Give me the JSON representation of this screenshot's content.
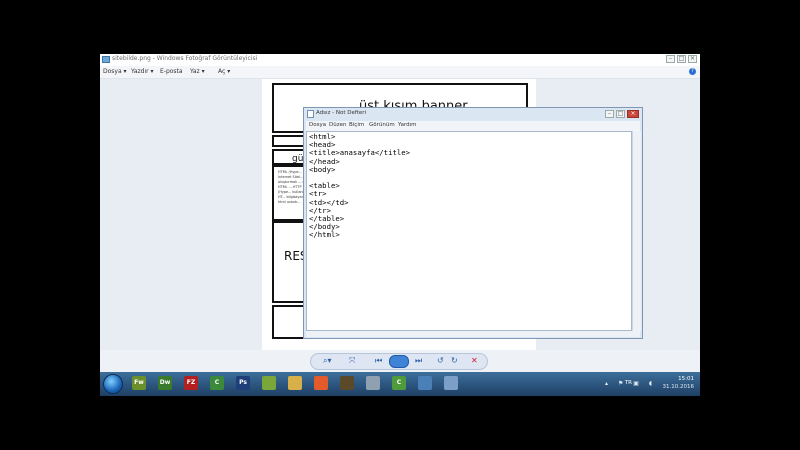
{
  "photo_viewer": {
    "title": "sitebilde.png - Windows Fotoğraf Görüntüleyicisi",
    "menu": [
      "Dosya ▾",
      "Yazdır ▾",
      "E-posta",
      "Yaz ▾",
      "Aç ▾"
    ],
    "image": {
      "banner": "üst kısım banner",
      "menu_label": "gü",
      "body_snippet": "HTML (Hype... İnternet Sitel... oluşturmak ... dilidir. HTML ... HTTP (Hype... kullanılır. HT... bilgisayara ... html uzantı...",
      "resource_label": "RES"
    },
    "controls": [
      "search-zoom",
      "actual-size",
      "prev",
      "slideshow",
      "next",
      "rotate-left",
      "rotate-right",
      "delete"
    ]
  },
  "notepad": {
    "title": "Adsız - Not Defteri",
    "menu": [
      "Dosya",
      "Düzen",
      "Biçim",
      "Görünüm",
      "Yardım"
    ],
    "content": "<html>\n<head>\n<title>anasayfa</title>\n</head>\n<body>\n\n<table>\n<tr>\n<td></td>\n</tr>\n</table>\n</body>\n</html>"
  },
  "taskbar": {
    "apps": [
      {
        "label": "Fw",
        "color": "#6b8f2a"
      },
      {
        "label": "Dw",
        "color": "#3a7a2c"
      },
      {
        "label": "FZ",
        "color": "#b32020"
      },
      {
        "label": "C",
        "color": "#3b8a3b"
      },
      {
        "label": "Ps",
        "color": "#1e3f7a"
      },
      {
        "label": "",
        "color": "#7aa63a"
      },
      {
        "label": "",
        "color": "#d8b04a"
      },
      {
        "label": "",
        "color": "#e35a2b"
      },
      {
        "label": "",
        "color": "#5a4a2a"
      },
      {
        "label": "",
        "color": "#8fa0b0"
      },
      {
        "label": "C",
        "color": "#4f9a3a"
      },
      {
        "label": "",
        "color": "#4b7fb8"
      },
      {
        "label": "",
        "color": "#7c9fc8"
      }
    ],
    "language": "TR",
    "time": "15:01",
    "date": "31.10.2016"
  }
}
